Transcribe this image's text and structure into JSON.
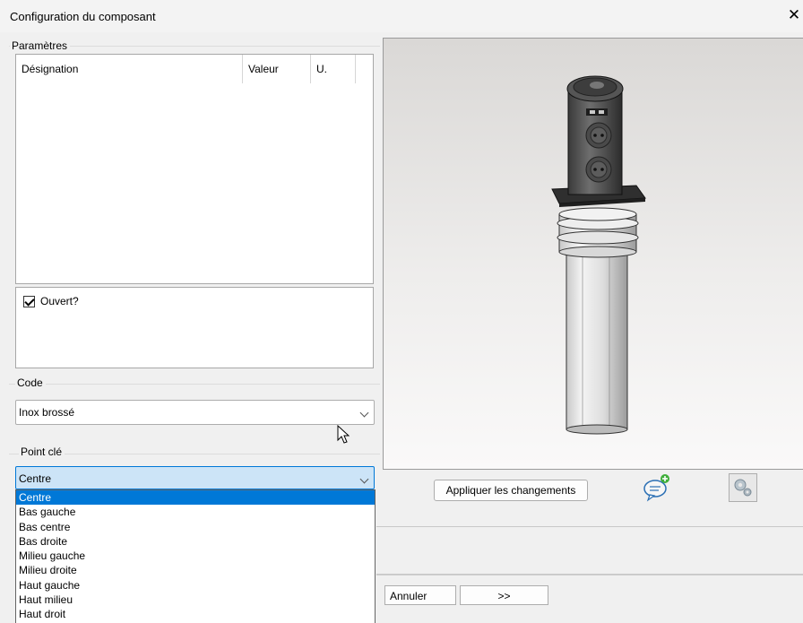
{
  "window": {
    "title": "Configuration du composant",
    "close_glyph": "✕"
  },
  "parameters": {
    "legend": "Paramètres",
    "columns": [
      "Désignation",
      "Valeur",
      "U."
    ]
  },
  "options": {
    "checkbox_label": "Ouvert?",
    "checked": true
  },
  "code": {
    "legend": "Code",
    "value": "Inox brossé"
  },
  "keypoint": {
    "legend": "Point clé",
    "value": "Centre",
    "items": [
      "Centre",
      "Bas gauche",
      "Bas centre",
      "Bas droite",
      "Milieu gauche",
      "Milieu droite",
      "Haut gauche",
      "Haut milieu",
      "Haut droit"
    ]
  },
  "preview": {
    "apply_label": "Appliquer les changements",
    "icons": [
      "comment-add-icon",
      "settings-icon"
    ]
  },
  "footer": {
    "cancel_label": "Annuler",
    "next_label": ">>"
  },
  "colors": {
    "accent": "#0078d7",
    "focus_bg": "#cce4f7",
    "comment_icon_green": "#3fae3a"
  }
}
